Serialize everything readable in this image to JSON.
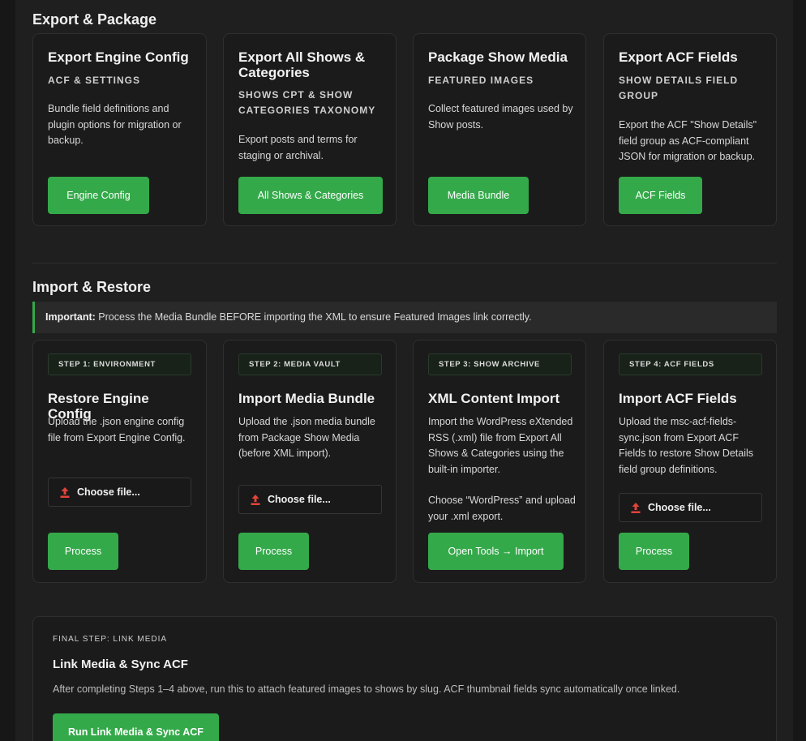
{
  "export": {
    "title": "Export & Package",
    "cards": [
      {
        "title": "Export Engine Config",
        "subtitle": "ACF & SETTINGS",
        "description": "Bundle field definitions and plugin options for migration or backup.",
        "button": "Engine Config"
      },
      {
        "title": "Export All Shows & Categories",
        "subtitle": "SHOWS CPT & SHOW CATEGORIES TAXONOMY",
        "description": "Export posts and terms for staging or archival.",
        "button": "All Shows & Categories"
      },
      {
        "title": "Package Show Media",
        "subtitle": "FEATURED IMAGES",
        "description": "Collect featured images used by Show posts.",
        "button": "Media Bundle"
      },
      {
        "title": "Export ACF Fields",
        "subtitle": "SHOW DETAILS FIELD GROUP",
        "description": "Export the ACF \"Show Details\" field group as ACF-compliant JSON for migration or backup.",
        "button": "ACF Fields"
      }
    ]
  },
  "import": {
    "title": "Import & Restore",
    "notice": {
      "strong": "Important:",
      "text": " Process the Media Bundle BEFORE importing the XML to ensure Featured Images link correctly."
    },
    "cards": [
      {
        "step": "STEP 1: ENVIRONMENT",
        "title": "Restore Engine Config",
        "description": "Upload the .json engine config file from Export Engine Config.",
        "file_label": "Choose file...",
        "button": "Process"
      },
      {
        "step": "STEP 2: MEDIA VAULT",
        "title": "Import Media Bundle",
        "description": "Upload the .json media bundle from Package Show Media (before XML import).",
        "file_label": "Choose file...",
        "button": "Process"
      },
      {
        "step": "STEP 3: SHOW ARCHIVE",
        "title": "XML Content Import",
        "description": "Import the WordPress eXtended RSS (.xml) file from Export All Shows & Categories using the built-in importer.",
        "description2": "Choose “WordPress” and upload your .xml export.",
        "button": "Open Tools → Import"
      },
      {
        "step": "STEP 4: ACF FIELDS",
        "title": "Import ACF Fields",
        "description": "Upload the msc-acf-fields-sync.json from Export ACF Fields to restore Show Details field group definitions.",
        "file_label": "Choose file...",
        "button": "Process"
      }
    ]
  },
  "final": {
    "step": "FINAL STEP: LINK MEDIA",
    "title": "Link Media & Sync ACF",
    "description": "After completing Steps 1–4 above, run this to attach featured images to shows by slug. ACF thumbnail fields sync automatically once linked.",
    "button": "Run Link Media & Sync ACF"
  },
  "icons": {
    "upload": "upload-icon"
  },
  "colors": {
    "accent": "#34a94a",
    "upload_icon": "#e0443a",
    "background": "#1f1f1f"
  }
}
